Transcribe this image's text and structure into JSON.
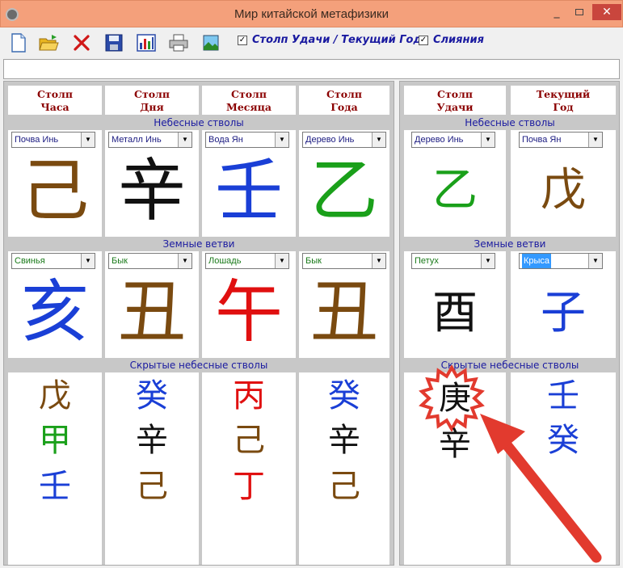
{
  "window": {
    "title": "Мир китайской метафизики",
    "min_label": "_",
    "close_label": "✕"
  },
  "toolbar": {
    "icons": [
      "new-document-icon",
      "open-folder-icon",
      "delete-icon",
      "save-icon",
      "chart-icon",
      "print-icon",
      "image-icon"
    ],
    "check_luck_year": {
      "label": "Столп Удачи / Текущий Год",
      "checked": true,
      "mark": "✓"
    },
    "check_merge": {
      "label": "Слияния",
      "checked": true,
      "mark": "✓"
    }
  },
  "left": {
    "headers": [
      {
        "line1": "Столп",
        "line2": "Часа"
      },
      {
        "line1": "Столп",
        "line2": "Дня"
      },
      {
        "line1": "Столп",
        "line2": "Месяца"
      },
      {
        "line1": "Столп",
        "line2": "Года"
      }
    ],
    "stems_label": "Небесные стволы",
    "branches_label": "Земные ветви",
    "hidden_label": "Скрытые небесные стволы",
    "stems": [
      {
        "option": "Почва Инь",
        "char": "己",
        "color": "#7a4a10"
      },
      {
        "option": "Металл Инь",
        "char": "辛",
        "color": "#111111"
      },
      {
        "option": "Вода Ян",
        "char": "壬",
        "color": "#1a3fd6"
      },
      {
        "option": "Дерево Инь",
        "char": "乙",
        "color": "#1aa01a"
      }
    ],
    "branches": [
      {
        "option": "Свинья",
        "char": "亥",
        "color": "#1a3fd6"
      },
      {
        "option": "Бык",
        "char": "丑",
        "color": "#7a4a10"
      },
      {
        "option": "Лошадь",
        "char": "午",
        "color": "#e01010"
      },
      {
        "option": "Бык",
        "char": "丑",
        "color": "#7a4a10"
      }
    ],
    "hidden": [
      [
        {
          "char": "戊",
          "color": "#7a4a10"
        },
        {
          "char": "甲",
          "color": "#1aa01a"
        },
        {
          "char": "壬",
          "color": "#1a3fd6"
        }
      ],
      [
        {
          "char": "癸",
          "color": "#1a3fd6"
        },
        {
          "char": "辛",
          "color": "#111111"
        },
        {
          "char": "己",
          "color": "#7a4a10"
        }
      ],
      [
        {
          "char": "丙",
          "color": "#e01010"
        },
        {
          "char": "己",
          "color": "#7a4a10"
        },
        {
          "char": "丁",
          "color": "#e01010"
        }
      ],
      [
        {
          "char": "癸",
          "color": "#1a3fd6"
        },
        {
          "char": "辛",
          "color": "#111111"
        },
        {
          "char": "己",
          "color": "#7a4a10"
        }
      ]
    ]
  },
  "right": {
    "headers": [
      {
        "line1": "Столп",
        "line2": "Удачи"
      },
      {
        "line1": "Текущий",
        "line2": "Год"
      }
    ],
    "stems_label": "Небесные стволы",
    "branches_label": "Земные ветви",
    "hidden_label": "Скрытые небесные стволы",
    "stems": [
      {
        "option": "Дерево Инь",
        "char": "乙",
        "color": "#1aa01a"
      },
      {
        "option": "Почва Ян",
        "char": "戊",
        "color": "#7a4a10"
      }
    ],
    "branches": [
      {
        "option": "Петух",
        "char": "酉",
        "color": "#111111",
        "selected": false
      },
      {
        "option": "Крыса",
        "char": "子",
        "color": "#1a3fd6",
        "selected": true
      }
    ],
    "hidden": [
      [
        {
          "char": "庚",
          "color": "#111111"
        },
        {
          "char": "辛",
          "color": "#111111"
        }
      ],
      [
        {
          "char": "壬",
          "color": "#1a3fd6"
        },
        {
          "char": "癸",
          "color": "#1a3fd6"
        }
      ]
    ]
  },
  "colors": {
    "titlebar": "#f4a07b",
    "option_text": "#1a1a80",
    "branch_option_text": "#1a7a1a",
    "selected_bg": "#3399ff",
    "annotation_red": "#e23a2e"
  }
}
